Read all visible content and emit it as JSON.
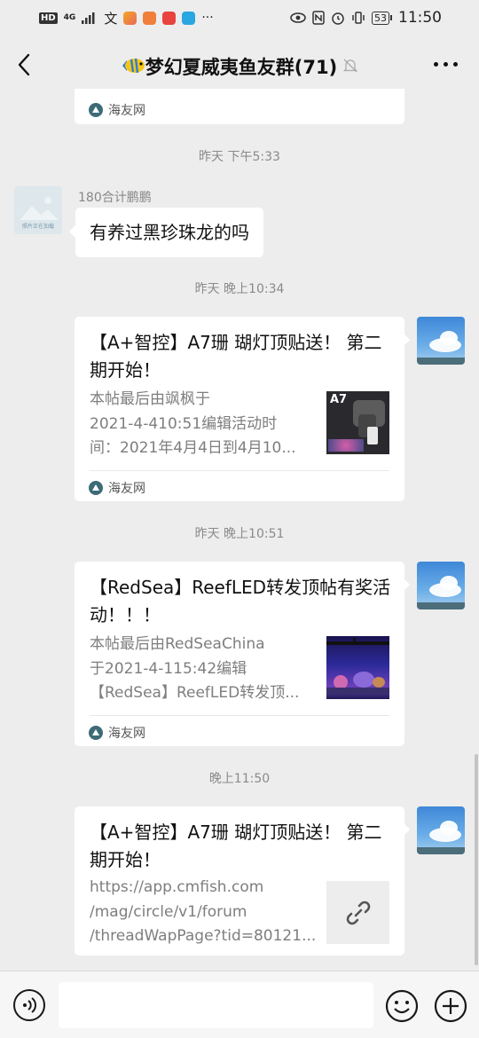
{
  "status_bar": {
    "hd": "HD",
    "network": "4G",
    "input_method": "文",
    "ellipsis": "···",
    "battery": "53",
    "time": "11:50"
  },
  "header": {
    "title": "梦幻夏威夷鱼友群(71)"
  },
  "messages": {
    "top_card": {
      "source": "海友网"
    },
    "ts1": "昨天 下午5:33",
    "ts2": "昨天 晚上10:34",
    "ts3": "昨天 晚上10:51",
    "ts4": "晚上11:50",
    "text_msg": {
      "sender": "180合计鹏鹏",
      "text": "有养过黑珍珠龙的吗",
      "avatar_caption": "照片正在加载"
    },
    "card1": {
      "title": "【A+智控】A7珊 瑚灯顶贴送！ 第二期开始！",
      "desc_line1": "本帖最后由飒枫于",
      "desc_line2": "2021-4-410:51编辑活动时",
      "desc_line3": "间：2021年4月4日到4月10...",
      "thumb_label": "A7",
      "source": "海友网"
    },
    "card2": {
      "title": "【RedSea】ReefLED转发顶帖有奖活动！！！",
      "desc_line1": "本帖最后由RedSeaChina",
      "desc_line2": "于2021-4-115:42编辑",
      "desc_line3": "【RedSea】ReefLED转发顶...",
      "source": "海友网"
    },
    "card3": {
      "title": "【A+智控】A7珊 瑚灯顶贴送！ 第二期开始！",
      "desc_line1": "https://app.cmfish.com",
      "desc_line2": "/mag/circle/v1/forum",
      "desc_line3": "/threadWapPage?tid=80121..."
    }
  },
  "input": {
    "value": ""
  },
  "colors": {
    "background": "#ededed",
    "bubble": "#ffffff",
    "timestamp": "#8a8a8a",
    "source_logo": "#3d6b77"
  }
}
